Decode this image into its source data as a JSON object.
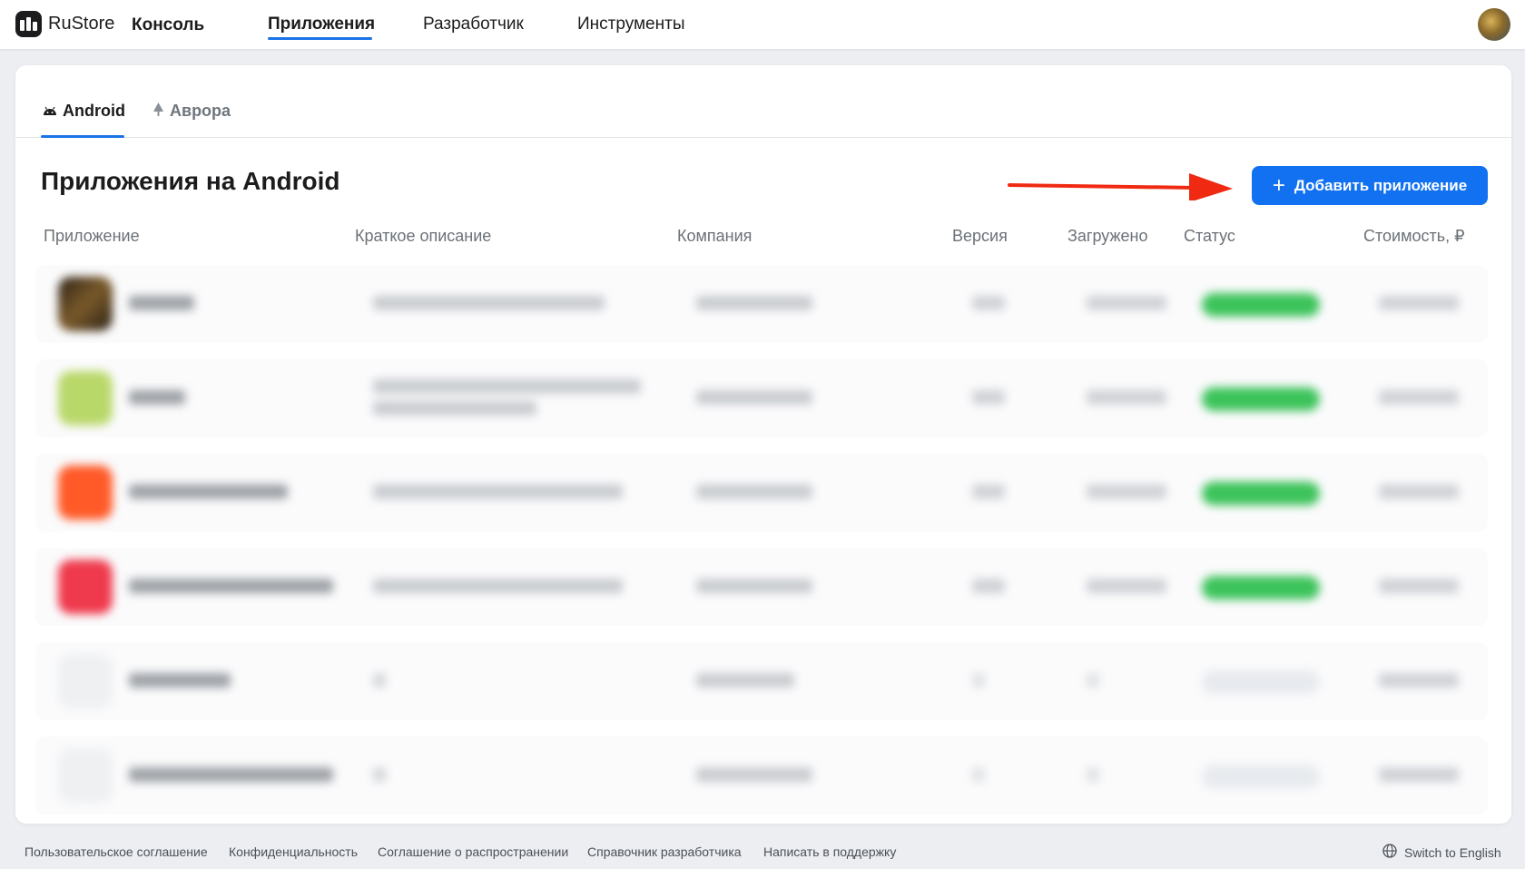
{
  "header": {
    "brand": "RuStore",
    "console_label": "Консоль",
    "nav": [
      {
        "label": "Приложения",
        "active": true
      },
      {
        "label": "Разработчик",
        "active": false
      },
      {
        "label": "Инструменты",
        "active": false
      }
    ],
    "avatar_icon": "user-avatar"
  },
  "platform_tabs": [
    {
      "label": "Android",
      "icon": "android-icon",
      "active": true
    },
    {
      "label": "Аврора",
      "icon": "aurora-icon",
      "active": false
    }
  ],
  "main": {
    "title": "Приложения на Android",
    "add_button_label": "Добавить приложение",
    "accent_color": "#1271f0"
  },
  "table": {
    "columns": [
      "Приложение",
      "Краткое описание",
      "Компания",
      "Версия",
      "Загружено",
      "Статус",
      "Стоимость, ₽"
    ],
    "rows": [
      {
        "icon_color": "#5a4326",
        "status": "active"
      },
      {
        "icon_color": "#b9d86a",
        "status": "active"
      },
      {
        "icon_color": "#ff5a28",
        "status": "active"
      },
      {
        "icon_color": "#ef3a4d",
        "status": "active"
      },
      {
        "icon_color": "#f1f2f4",
        "status": "draft"
      },
      {
        "icon_color": "#f1f2f4",
        "status": "draft"
      }
    ]
  },
  "footer": {
    "links": [
      "Пользовательское соглашение",
      "Конфиденциальность",
      "Соглашение о распространении",
      "Справочник разработчика",
      "Написать в поддержку"
    ],
    "language_switch": "Switch to English",
    "language_icon": "globe-icon"
  }
}
